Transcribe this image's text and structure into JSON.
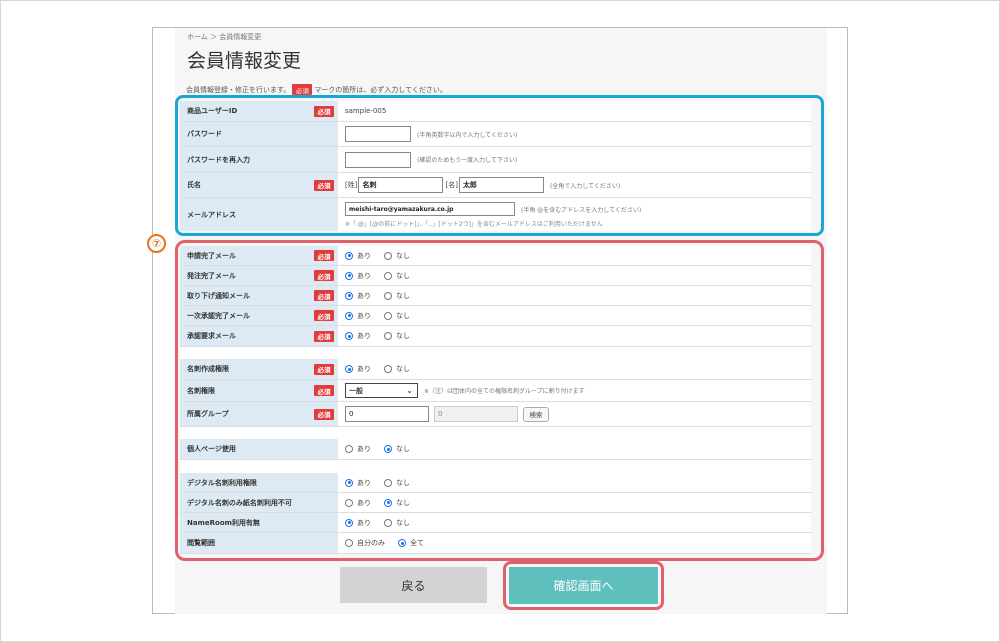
{
  "breadcrumb": "ホーム ＞ 会員情報変更",
  "page_title": "会員情報変更",
  "intro": {
    "before": "会員情報登録・修正を行います。",
    "req": "必須",
    "after": "マークの箇所は、必ず入力してください。"
  },
  "required_label": "必須",
  "account": {
    "user_id": {
      "label": "商品ユーザーID",
      "value": "sample-005"
    },
    "password": {
      "label": "パスワード",
      "hint": "(半角英数字以内で入力してください)"
    },
    "password_confirm": {
      "label": "パスワードを再入力",
      "hint": "(確認のためもう一度入力して下さい)"
    },
    "name": {
      "label": "氏名",
      "sei_prefix": "[姓]",
      "sei_value": "名刺",
      "mei_prefix": "[名]",
      "mei_value": "太郎",
      "hint": "(全角で入力してください)"
    },
    "email": {
      "label": "メールアドレス",
      "value": "meishi-taro@yamazakura.co.jp",
      "hint": "(半角 @を含むアドレスを入力してください)",
      "note": "※「.@」[@の前にドット]」、「..」[ドット2つ]」を含むメールアドレスはご利用いただけません"
    }
  },
  "radio_yes": "あり",
  "radio_no": "なし",
  "settings": {
    "mail_rows": [
      {
        "label": "申請完了メール",
        "value": "あり"
      },
      {
        "label": "発注完了メール",
        "value": "あり"
      },
      {
        "label": "取り下げ通知メール",
        "value": "あり"
      },
      {
        "label": "一次承認完了メール",
        "value": "あり"
      },
      {
        "label": "承認要求メール",
        "value": "あり"
      }
    ],
    "card_create": {
      "label": "名刺作成権限",
      "value": "あり"
    },
    "card_auth": {
      "label": "名刺権限",
      "selected": "一般",
      "hint": "※（注）は団体内の全ての権限名刺グループに割り付けます"
    },
    "group": {
      "label": "所属グループ",
      "value1": "0",
      "value2": "0",
      "search": "検索"
    },
    "personal_page": {
      "label": "個人ページ使用",
      "value": "なし"
    },
    "digital_rows": [
      {
        "label": "デジタル名刺利用権限",
        "value": "あり"
      },
      {
        "label": "デジタル名刺のみ紙名刺利用不可",
        "value": "なし"
      },
      {
        "label": "NameRoom利用有無",
        "value": "あり"
      }
    ],
    "scope": {
      "label": "閲覧範囲",
      "opt1": "自分のみ",
      "opt2": "全て",
      "selected": "全て"
    }
  },
  "buttons": {
    "back": "戻る",
    "confirm": "確認画面へ"
  },
  "annotation_number": "⑦",
  "colors": {
    "highlight_blue": "#1aa6d8",
    "highlight_red": "#e0616b",
    "required_red": "#e23b3b",
    "confirm_teal": "#5fbfbd",
    "back_gray": "#d3d3d3",
    "label_bg": "#ddeaf3"
  }
}
